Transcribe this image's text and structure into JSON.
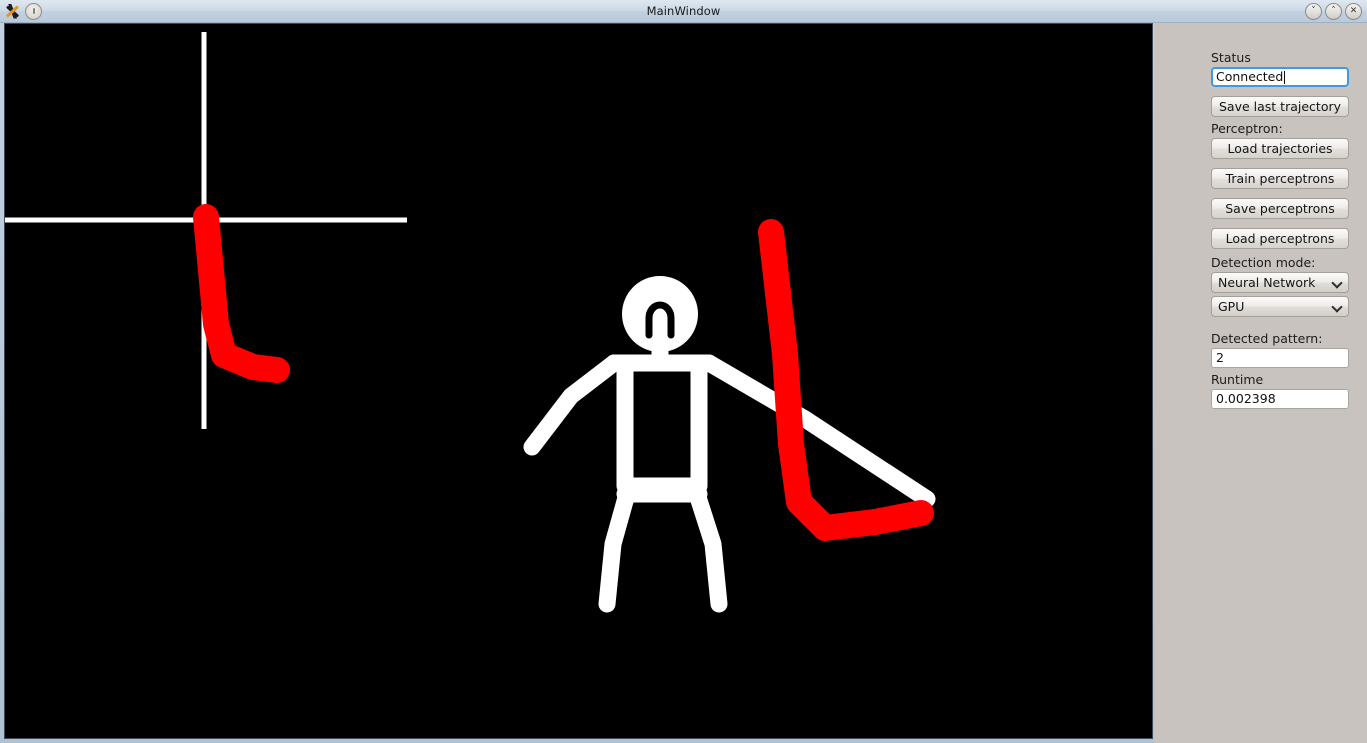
{
  "window": {
    "title": "MainWindow",
    "app_icon": "app-x-icon",
    "menu_icon": "circle-dot-icon",
    "controls": {
      "minimize": "˅",
      "maximize": "˄",
      "close": "✕"
    }
  },
  "panel": {
    "status_label": "Status",
    "status_value": "Connected",
    "save_last_trajectory": "Save last trajectory",
    "perceptron_label": "Perceptron:",
    "load_trajectories": "Load trajectories",
    "train_perceptrons": "Train perceptrons",
    "save_perceptrons": "Save perceptrons",
    "load_perceptrons": "Load perceptrons",
    "detection_mode_label": "Detection mode:",
    "detection_mode_value": "Neural Network",
    "detection_mode_options": [
      "Neural Network"
    ],
    "device_value": "GPU",
    "device_options": [
      "GPU"
    ],
    "detected_pattern_label": "Detected pattern:",
    "detected_pattern_value": "2",
    "runtime_label": "Runtime",
    "runtime_value": "0.002398"
  },
  "canvas": {
    "background_color": "#000000",
    "skeleton_color": "#FFFFFF",
    "trajectory_color": "#FF0000",
    "axis_color": "#FFFFFF",
    "inset_axis_description": "coordinate cross with recorded L-shaped gesture trajectory",
    "figure_description": "tracked human skeleton stick figure with live gesture trajectory"
  }
}
